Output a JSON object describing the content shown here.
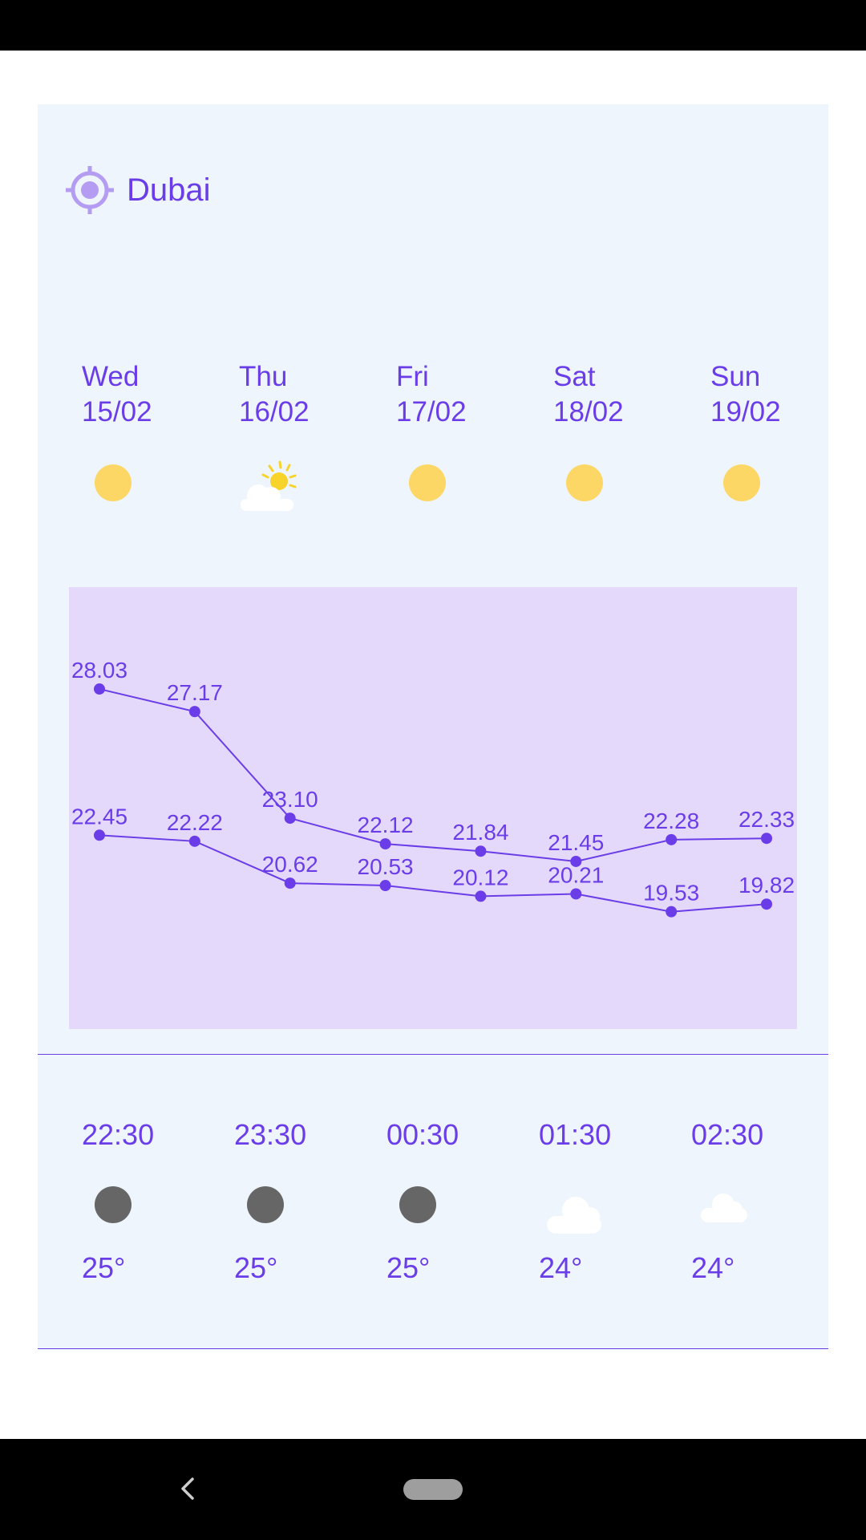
{
  "location": {
    "name": "Dubai",
    "icon": "location-target-icon"
  },
  "daily": [
    {
      "weekday": "Wed",
      "date": "15/02",
      "icon": "sun-icon"
    },
    {
      "weekday": "Thu",
      "date": "16/02",
      "icon": "partly-sunny-icon"
    },
    {
      "weekday": "Fri",
      "date": "17/02",
      "icon": "sun-icon"
    },
    {
      "weekday": "Sat",
      "date": "18/02",
      "icon": "sun-icon"
    },
    {
      "weekday": "Sun",
      "date": "19/02",
      "icon": "sun-icon"
    }
  ],
  "chart_data": {
    "type": "line",
    "title": "",
    "xlabel": "",
    "ylabel": "",
    "series": [
      {
        "values": [
          28.03,
          27.17,
          23.1,
          22.12,
          21.84,
          21.45,
          22.28,
          22.33
        ]
      },
      {
        "values": [
          22.45,
          22.22,
          20.62,
          20.53,
          20.12,
          20.21,
          19.53,
          19.82
        ]
      }
    ],
    "labels": [
      [
        "28.03",
        "27.17",
        "23.10",
        "22.12",
        "21.84",
        "21.45",
        "22.28",
        "22.33"
      ],
      [
        "22.45",
        "22.22",
        "20.62",
        "20.53",
        "20.12",
        "20.21",
        "19.53",
        "19.82"
      ]
    ],
    "ylim": [
      17.5,
      29.5
    ],
    "grid": false,
    "colors": {
      "line": "#6a3de8",
      "background": "#e5d9fb"
    }
  },
  "hourly": [
    {
      "time": "22:30",
      "temp": "25°",
      "icon": "moon-dot-icon"
    },
    {
      "time": "23:30",
      "temp": "25°",
      "icon": "moon-dot-icon"
    },
    {
      "time": "00:30",
      "temp": "25°",
      "icon": "moon-dot-icon"
    },
    {
      "time": "01:30",
      "temp": "24°",
      "icon": "cloud-icon"
    },
    {
      "time": "02:30",
      "temp": "24°",
      "icon": "small-cloud-icon"
    }
  ],
  "colors": {
    "accent": "#6a3de8",
    "card": "#eef5fd",
    "sun": "#fcd766",
    "night": "#666666"
  }
}
